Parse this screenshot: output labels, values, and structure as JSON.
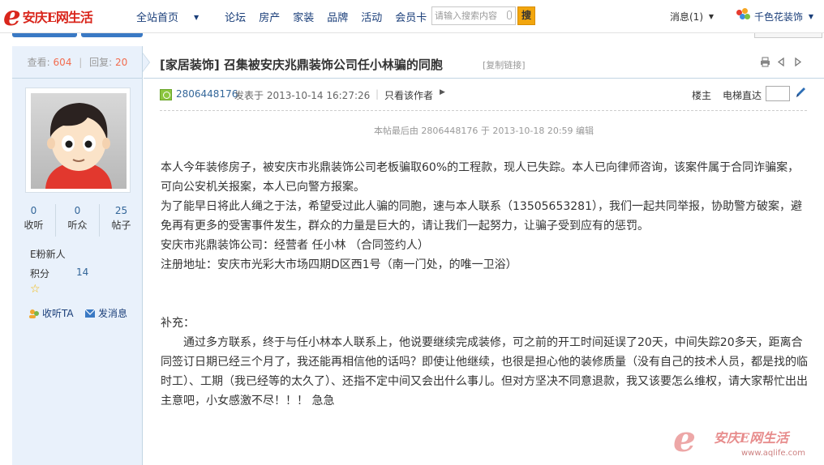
{
  "header": {
    "logo_e": "e",
    "logo_text": "安庆E网生活",
    "nav": [
      {
        "label": "全站首页",
        "dropdown": true
      },
      {
        "label": "论坛",
        "dropdown": false
      },
      {
        "label": "房产",
        "dropdown": false
      },
      {
        "label": "家装",
        "dropdown": false
      },
      {
        "label": "品牌",
        "dropdown": false
      },
      {
        "label": "活动",
        "dropdown": false
      },
      {
        "label": "会员卡",
        "dropdown": false
      }
    ],
    "search_placeholder": "请输入搜索内容",
    "search_button": "搜",
    "messages": "消息(1)",
    "site_name": "千色花装饰",
    "caret": "▼"
  },
  "sidebar": {
    "views_label": "查看:",
    "views": "604",
    "sep": "|",
    "replies_label": "回复:",
    "replies": "20",
    "counts": [
      {
        "value": "0",
        "label": "收听"
      },
      {
        "value": "0",
        "label": "听众"
      },
      {
        "value": "25",
        "label": "帖子"
      }
    ],
    "level": "E粉新人",
    "points_label": "积分",
    "points": "14",
    "star": "☆",
    "follow_label": "收听TA",
    "send_msg_label": "发消息"
  },
  "post": {
    "title": "[家居装饰] 召集被安庆兆鼎装饰公司任小林骗的同胞",
    "copy_link": "[复制链接]",
    "author": "2806448176",
    "posted_at": "发表于 2013-10-14 16:27:26",
    "meta_sep": "|",
    "only_author": "只看该作者",
    "floor_owner": "楼主",
    "jump_label": "电梯直达",
    "edit_note": "本帖最后由 2806448176 于 2013-10-18 20:59 编辑",
    "paragraphs": [
      "本人今年装修房子，被安庆市兆鼎装饰公司老板骗取60%的工程款，现人已失踪。本人已向律师咨询，该案件属于合同诈骗案，可向公安机关报案，本人已向警方报案。",
      "为了能早日将此人绳之于法，希望受过此人骗的同胞，速与本人联系（13505653281），我们一起共同举报，协助警方破案，避免再有更多的受害事件发生，群众的力量是巨大的，请让我们一起努力，让骗子受到应有的惩罚。",
      "安庆市兆鼎装饰公司：经营者 任小林 （合同签约人）",
      "注册地址：安庆市光彩大市场四期D区西1号（南一门处，的唯一卫浴）"
    ],
    "supplement_title": "补充：",
    "supplement": "　　通过多方联系，终于与任小林本人联系上，他说要继续完成装修，可之前的开工时间延误了20天，中间失踪20多天，距离合同签订日期已经三个月了，我还能再相信他的话吗？即使让他继续，也很是担心他的装修质量（没有自己的技术人员，都是找的临时工）、工期（我已经等的太久了）、还指不定中间又会出什么事儿。但对方坚决不同意退款，我又该要怎么维权，请大家帮忙出出主意吧，小女感激不尽！！！ 急急"
  },
  "watermark": {
    "e": "e",
    "text": "安庆E网生活",
    "url": "www.aqlife.com"
  }
}
